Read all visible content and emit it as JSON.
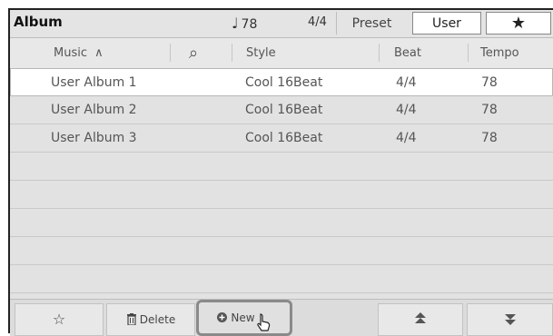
{
  "header": {
    "title": "Album",
    "tempo_glyph": "♩",
    "tempo_value": "78",
    "meter": "4/4",
    "tabs": {
      "preset": "Preset",
      "user": "User",
      "favorite_glyph": "★"
    }
  },
  "columns": {
    "music": "Music",
    "sort_glyph": "∧",
    "search_glyph": "⌕",
    "style": "Style",
    "beat": "Beat",
    "tempo": "Tempo"
  },
  "rows": [
    {
      "music": "User Album 1",
      "style": "Cool 16Beat",
      "beat": "4/4",
      "tempo": "78"
    },
    {
      "music": "User Album 2",
      "style": "Cool 16Beat",
      "beat": "4/4",
      "tempo": "78"
    },
    {
      "music": "User Album 3",
      "style": "Cool 16Beat",
      "beat": "4/4",
      "tempo": "78"
    }
  ],
  "footer": {
    "favorite_glyph": "☆",
    "delete_glyph": "🗑",
    "delete_label": "Delete",
    "new_glyph": "⊕",
    "new_label": "New",
    "up_glyph": "▲",
    "down_glyph": "▼"
  }
}
